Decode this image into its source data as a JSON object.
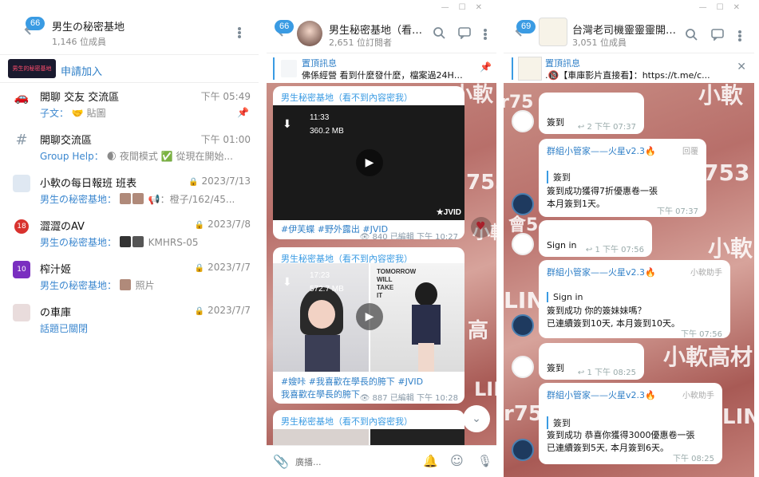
{
  "colors": {
    "accent": "#3a9be3",
    "link": "#2f7fc7"
  },
  "panel1": {
    "header": {
      "badge": "66",
      "title": "男生の秘密基地",
      "members": "1,146 位成員"
    },
    "join": {
      "thumb_text": "男生的秘密基地",
      "label": "申請加入"
    },
    "topics": [
      {
        "icon": "car-icon",
        "name": "開聊 交友 交流區",
        "time": "下午 05:49",
        "preview_sender": "子文：",
        "preview_text": "🤝 貼圖",
        "pinned": true
      },
      {
        "icon": "hash-icon",
        "name": "開聊交流區",
        "time": "下午 01:00",
        "preview_sender": "Group Help：",
        "preview_text": "🌒 夜間模式 ✅ 從現在開始...",
        "pinned": false
      },
      {
        "icon": "topic-avatar-icon",
        "name": "小軟の每日報班 班表",
        "time": "2023/7/13",
        "preview_sender": "男生の秘密基地：",
        "preview_text": "📢：橙子/162/45...",
        "pinned": false
      },
      {
        "icon": "18-badge-icon",
        "name": "澀澀のAV",
        "time": "2023/7/8",
        "preview_sender": "男生の秘密基地：",
        "preview_text": "KMHRS-05",
        "pinned": false
      },
      {
        "icon": "topic-avatar-icon",
        "name": "榨汁姬",
        "time": "2023/7/7",
        "preview_sender": "男生の秘密基地：",
        "preview_text": "照片",
        "pinned": false
      },
      {
        "icon": "topic-avatar-icon",
        "name": "の車庫",
        "time": "2023/7/7",
        "preview_sender": "",
        "preview_text": "話題已關閉",
        "pinned": false
      }
    ]
  },
  "panel2": {
    "header": {
      "badge": "66",
      "title": "男生秘密基地（看不到內...",
      "subscribers": "2,651 位訂閱者"
    },
    "pinned": {
      "label": "置頂訊息",
      "text": "佛係經營 看到什麼發什麼，檔案過24H刪..."
    },
    "posts": [
      {
        "from": "男生秘密基地（看不到內容密我）",
        "duration": "11:33",
        "size": "360.2 MB",
        "tags": "#伊芙蝶 #野外露出 #JVID",
        "views": "840",
        "meta": "已編輯 下午 10:27"
      },
      {
        "from": "男生秘密基地（看不到內容密我）",
        "duration": "17:23",
        "size": "572.7 MB",
        "tags": "#嫂咔 #我喜歡在學長的胯下 #JVID",
        "caption": "我喜歡在學長的胯下",
        "views": "887",
        "meta": "已編輯 下午 10:28"
      },
      {
        "from": "男生秘密基地（看不到內容密我）"
      }
    ],
    "compose_placeholder": "廣播..."
  },
  "panel3": {
    "header": {
      "badge": "69",
      "title": "台灣老司機靈靈靈開聊群",
      "members": "3,051 位成員"
    },
    "pinned": {
      "label": "置頂訊息",
      "text": ".🔞【車庫影片直接看】：https://t.me/c..."
    },
    "messages": [
      {
        "type": "user",
        "text": "簽到",
        "replies": "2",
        "time": "下午 07:37"
      },
      {
        "type": "bot",
        "name": "群組小管家——火星v2.3🔥",
        "role": "回覆",
        "quote": "簽到",
        "lines": [
          "簽到成功獲得7折優惠卷一張",
          "本月簽到1天。"
        ],
        "time": "下午 07:37"
      },
      {
        "type": "user",
        "text": "Sign in",
        "replies": "1",
        "time": "下午 07:56"
      },
      {
        "type": "bot",
        "name": "群組小管家——火星v2.3🔥",
        "role": "小軟助手",
        "quote": "Sign in",
        "lines": [
          "簽到成功  你的簽妹妹嗎？",
          "已連續簽到10天, 本月簽到10天。"
        ],
        "time": "下午 07:56"
      },
      {
        "type": "user",
        "text": "簽到",
        "replies": "1",
        "time": "下午 08:25"
      },
      {
        "type": "bot",
        "name": "群組小管家——火星v2.3🔥",
        "role": "小軟助手",
        "quote": "簽到",
        "lines": [
          "簽到成功  恭喜你獲得3000優惠卷一張",
          "已連續簽到5天, 本月簽到6天。"
        ],
        "time": "下午 08:25"
      }
    ]
  },
  "watermarks": [
    "小軟",
    "753",
    "小軟",
    "會5",
    "LIN",
    "高",
    "小軟高材",
    "r75",
    "753",
    "小軟",
    "LIN",
    "高材"
  ]
}
